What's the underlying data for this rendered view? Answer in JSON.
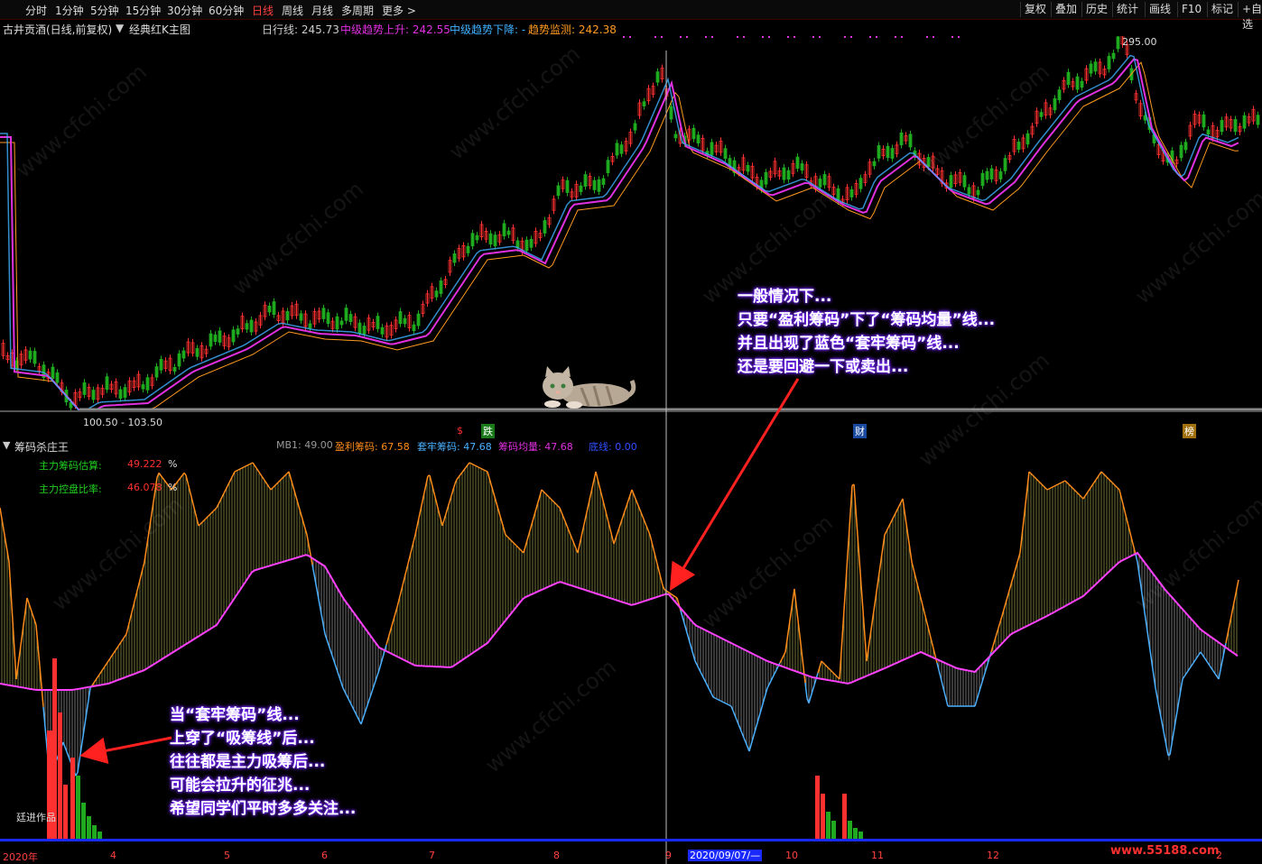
{
  "toolbar": {
    "tabs": [
      "分时",
      "1分钟",
      "5分钟",
      "15分钟",
      "30分钟",
      "60分钟",
      "日线",
      "周线",
      "月线",
      "多周期",
      "更多 >"
    ],
    "active_tab": "日线",
    "right_buttons": [
      "复权",
      "叠加",
      "历史",
      "统计",
      "画线",
      "F10",
      "标记",
      "+自选"
    ]
  },
  "info": {
    "stock": "古井贡酒(日线,前复权)",
    "template": "经典红K主图",
    "daily_line": "日行线: 245.73",
    "trend_up": "中级趋势上升: 242.55",
    "trend_down": "中级趋势下降: -",
    "trend_monitor": "趋势监测: 242.38"
  },
  "price_labels": {
    "high": "295.00",
    "low": "100.50 - 103.50"
  },
  "event_markers": {
    "s": "$",
    "die": "跌",
    "cai": "财",
    "bang": "榜"
  },
  "indicator": {
    "name": "筹码杀庄王",
    "mb1": "MB1: 49.00",
    "profit": "盈利筹码: 67.58",
    "trapped": "套牢筹码: 47.68",
    "avg": "筹码均量: 47.68",
    "bottom": "底线: 0.00",
    "est_label": "主力筹码估算:",
    "est_value": "49.222",
    "est_unit": "%",
    "ctrl_label": "主力控盘比率:",
    "ctrl_value": "46.078",
    "ctrl_unit": "%",
    "author": "廷进作品"
  },
  "annotations": {
    "top": [
      "一般情况下...",
      "只要“盈利筹码”下了“筹码均量”线...",
      "并且出现了蓝色“套牢筹码”线...",
      "还是要回避一下或卖出..."
    ],
    "bottom": [
      "当“套牢筹码”线...",
      "上穿了“吸筹线”后...",
      "往往都是主力吸筹后...",
      "可能会拉升的征兆...",
      "希望同学们平时多多关注..."
    ]
  },
  "xaxis": [
    "2020年",
    "4",
    "5",
    "6",
    "7",
    "8",
    "9",
    "2020/09/07/—",
    "10",
    "11",
    "12",
    "2"
  ],
  "footer_site": "www.55188.com",
  "watermark": "www.cfchi.com",
  "colors": {
    "up": "#ff3030",
    "down": "#1faa1f",
    "ma_pink": "#e030e0",
    "ma_blue": "#3fb0ff",
    "ma_orange": "#ff9a20",
    "profit_orange": "#ff8c1a",
    "trapped_blue": "#4ab0ff"
  }
}
